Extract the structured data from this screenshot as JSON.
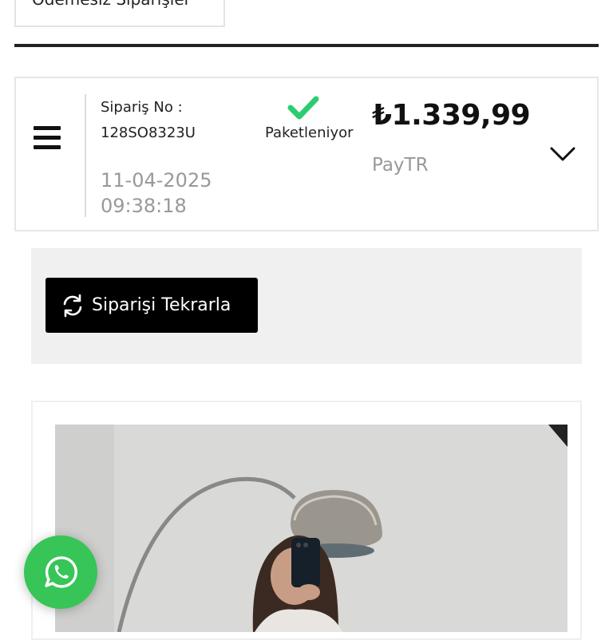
{
  "tabs": {
    "unpaid_orders_label": "Ödemesiz Siparişler"
  },
  "order": {
    "number_label": "Sipariş No :",
    "number": "128SO8323U",
    "date": "11-04-2025",
    "time": "09:38:18",
    "status": "Paketleniyor",
    "price": "₺1.339,99",
    "payment_method": "PayTR"
  },
  "actions": {
    "reorder_label": "Siparişi Tekrarla"
  },
  "colors": {
    "status_check": "#2ecc71",
    "whatsapp": "#37c558",
    "reorder_button_bg": "#000000",
    "reorder_panel_bg": "#f0f0f0"
  },
  "icons": {
    "menu": "hamburger-menu-icon",
    "status": "check-icon",
    "expand": "chevron-down-icon",
    "reorder": "refresh-icon",
    "chat": "whatsapp-icon"
  }
}
